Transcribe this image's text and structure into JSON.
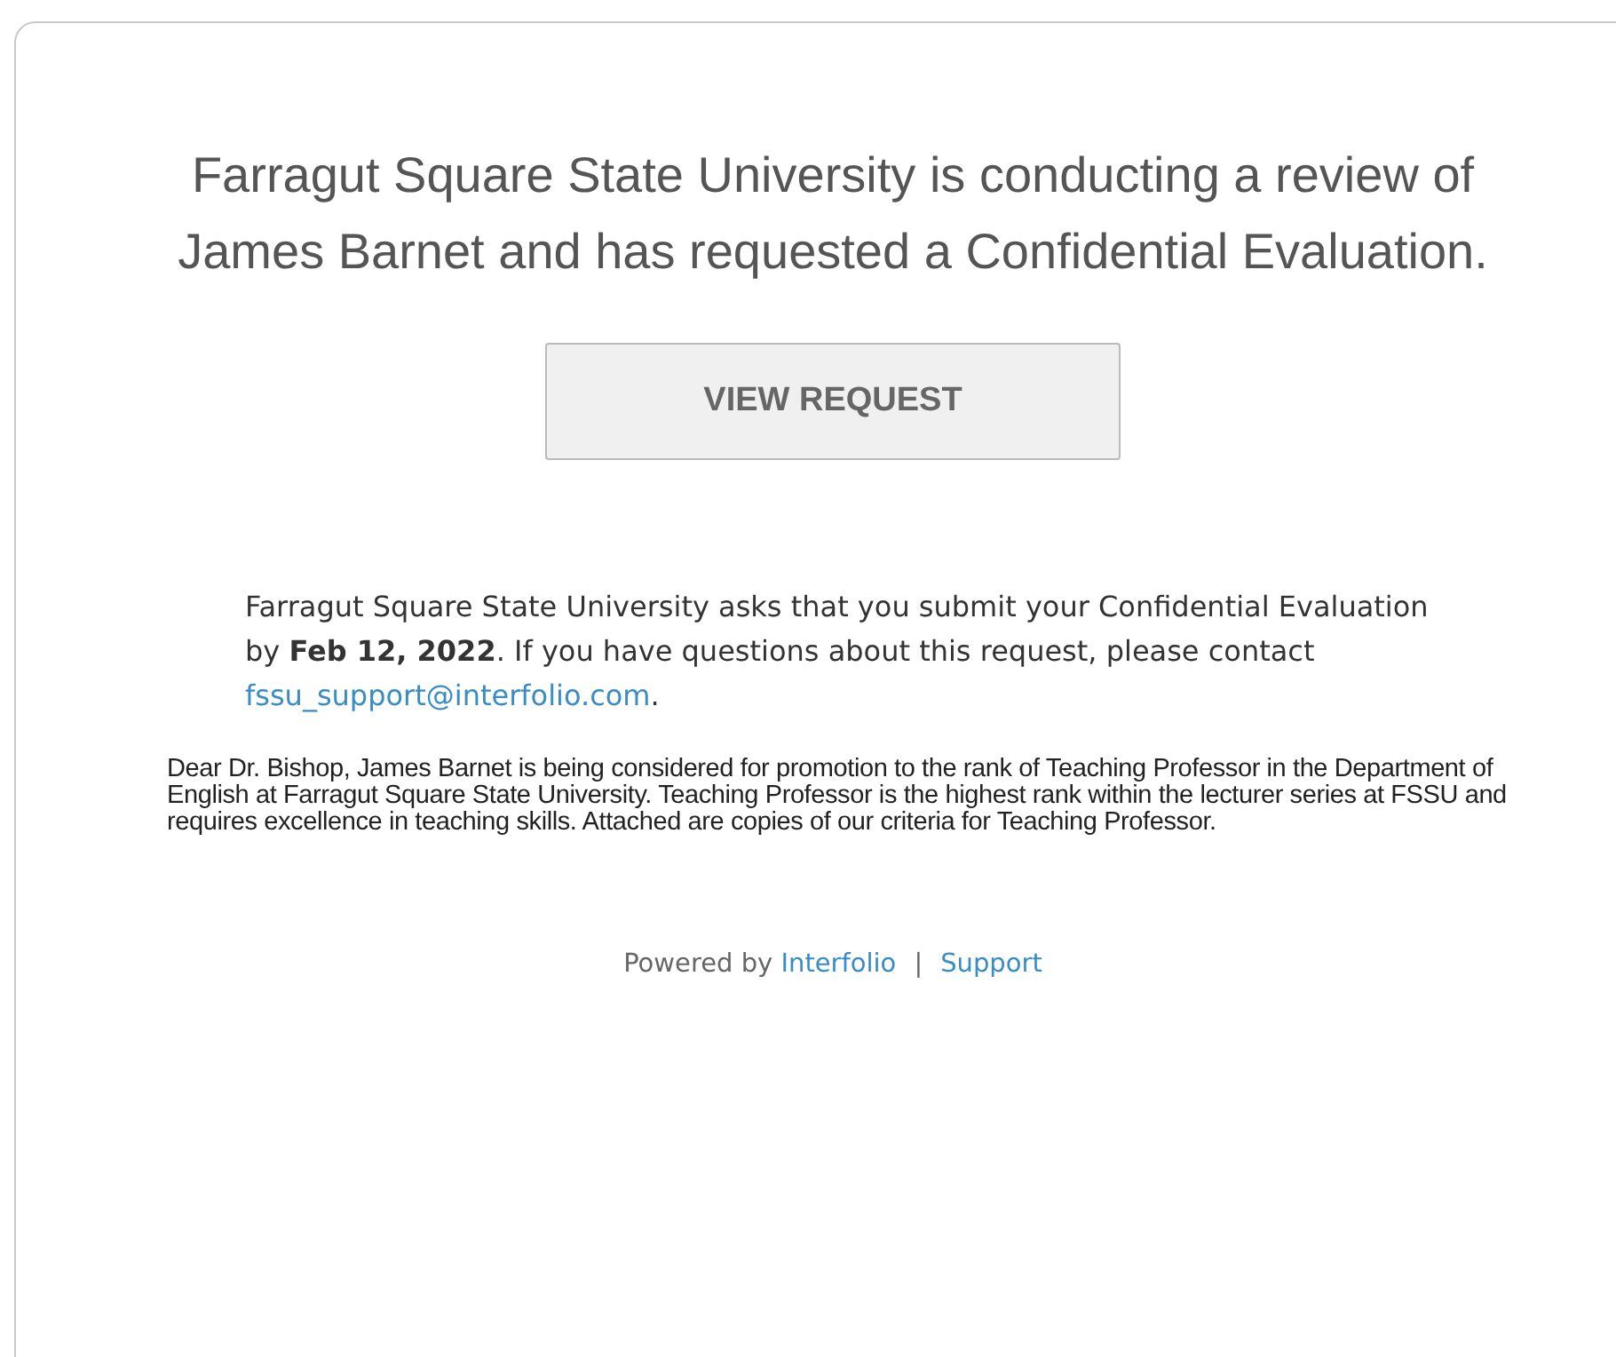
{
  "headline": "Farragut Square State University is conducting a review of James Barnet and has requested a Confidential Evaluation.",
  "button": "VIEW REQUEST",
  "deadline": {
    "text": "Farragut Square State University asks that you submit your Confidential Evaluation by **Feb 12, 2022**. If you have questions about this request, please contact",
    "email": "fssu_support@interfolio.com",
    "after": "."
  },
  "letter": "Dear Dr. Bishop, James Barnet is being considered for promotion to the rank of Teaching Professor in the Department of English at Farragut Square State University. Teaching Professor is the highest rank  within the lecturer series at FSSU and requires excellence in teaching skills. Attached are copies of our criteria for Teaching Professor.",
  "footer": {
    "powered_by": "Powered by",
    "brand_link": "Interfolio",
    "separator": "|",
    "support_link": "Support"
  }
}
